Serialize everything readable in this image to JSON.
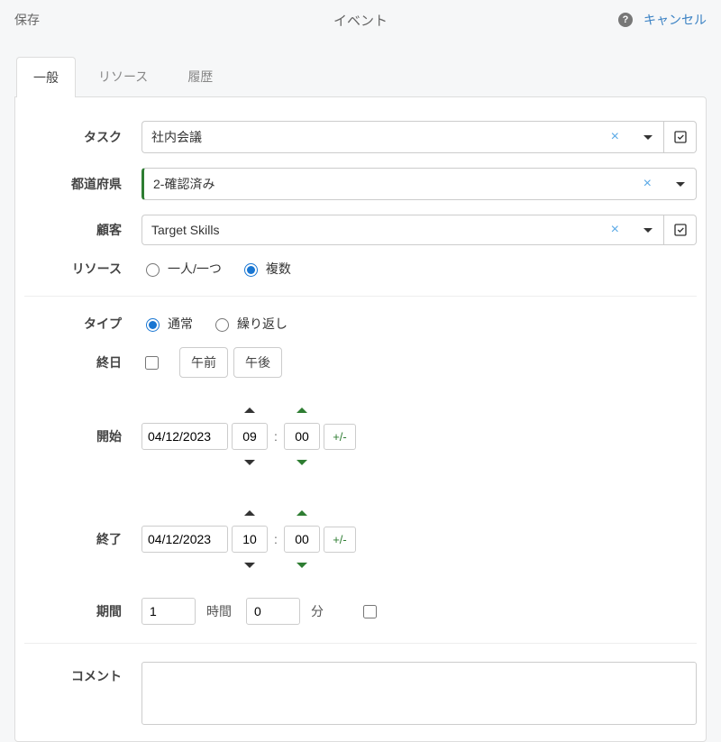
{
  "header": {
    "save": "保存",
    "title": "イベント",
    "cancel": "キャンセル"
  },
  "tabs": [
    {
      "label": "一般"
    },
    {
      "label": "リソース"
    },
    {
      "label": "履歴"
    }
  ],
  "form": {
    "task": {
      "label": "タスク",
      "value": "社内会議"
    },
    "prefecture": {
      "label": "都道府県",
      "value": "2-確認済み"
    },
    "customer": {
      "label": "顧客",
      "value": "Target Skills"
    },
    "resource": {
      "label": "リソース",
      "options": {
        "single": "一人/一つ",
        "multi": "複数"
      }
    },
    "type": {
      "label": "タイプ",
      "options": {
        "normal": "通常",
        "repeat": "繰り返し"
      }
    },
    "allday": {
      "label": "終日",
      "am": "午前",
      "pm": "午後"
    },
    "start": {
      "label": "開始",
      "date": "04/12/2023",
      "hour": "09",
      "minute": "00",
      "pm": "+/-"
    },
    "end": {
      "label": "終了",
      "date": "04/12/2023",
      "hour": "10",
      "minute": "00",
      "pm": "+/-"
    },
    "duration": {
      "label": "期間",
      "hours": "1",
      "hours_unit": "時間",
      "minutes": "0",
      "minutes_unit": "分"
    },
    "comment": {
      "label": "コメント"
    }
  }
}
